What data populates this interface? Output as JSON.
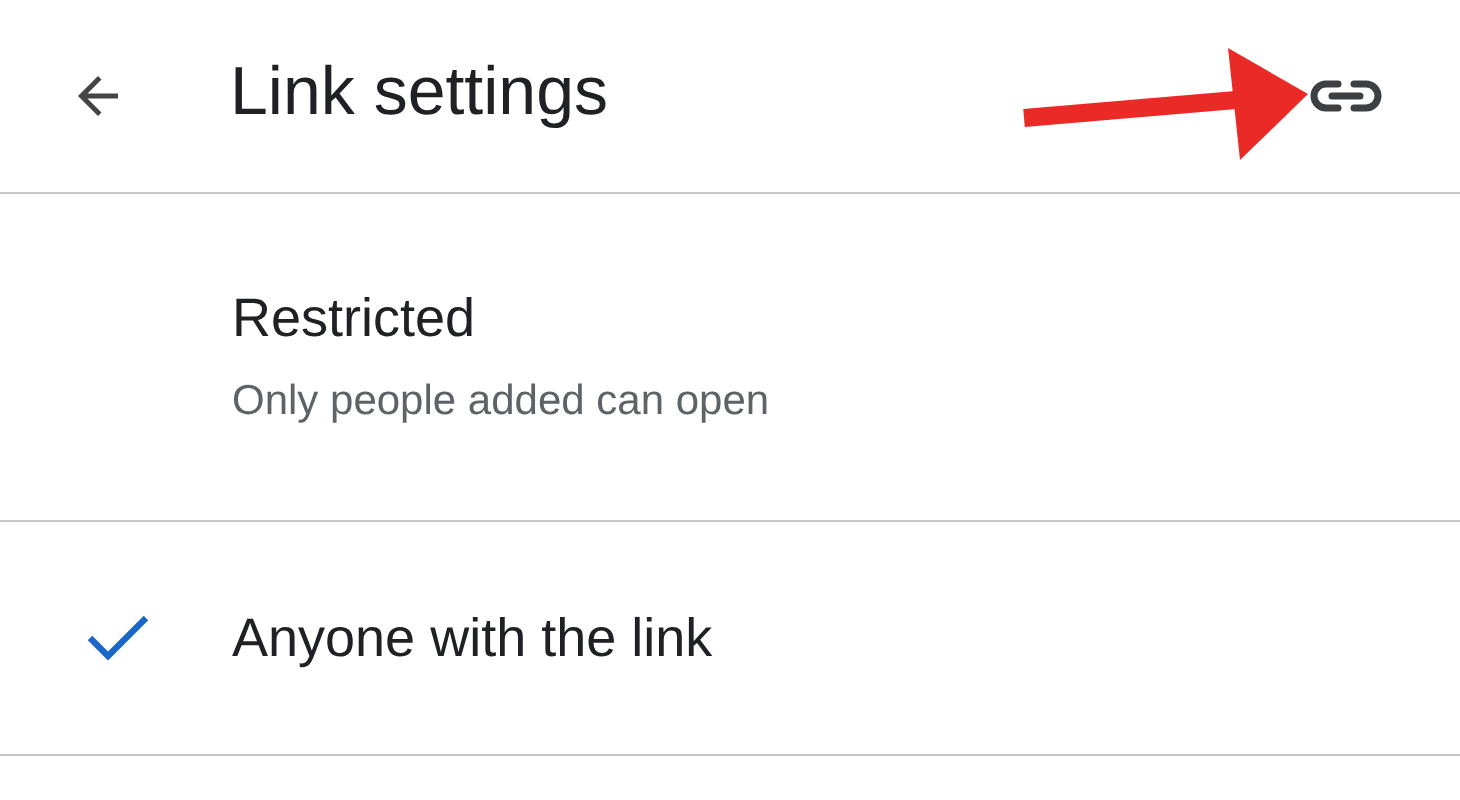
{
  "header": {
    "title": "Link settings"
  },
  "options": [
    {
      "label": "Restricted",
      "description": "Only people added can open",
      "selected": false
    },
    {
      "label": "Anyone with the link",
      "selected": true
    }
  ]
}
